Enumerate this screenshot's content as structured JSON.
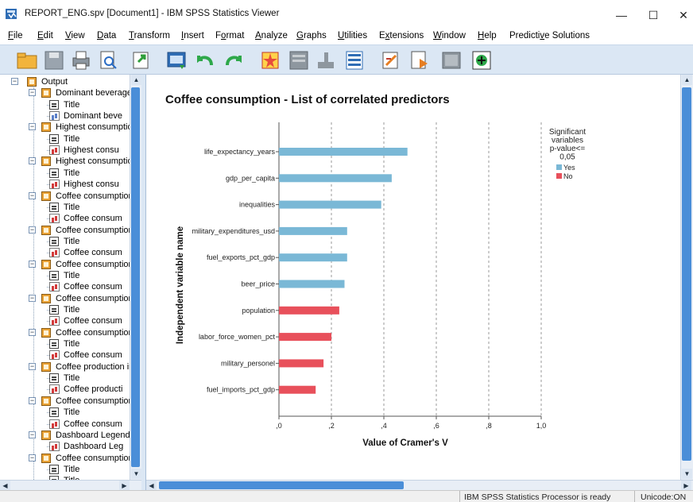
{
  "window": {
    "title": "REPORT_ENG.spv [Document1] - IBM SPSS Statistics Viewer",
    "minimize": "—",
    "maximize": "☐",
    "close": "✕"
  },
  "menu": [
    {
      "label": "File",
      "ul": "F",
      "rest": "ile"
    },
    {
      "label": "Edit",
      "ul": "E",
      "rest": "dit"
    },
    {
      "label": "View",
      "ul": "V",
      "rest": "iew"
    },
    {
      "label": "Data",
      "ul": "D",
      "rest": "ata"
    },
    {
      "label": "Transform",
      "ul": "T",
      "rest": "ransform"
    },
    {
      "label": "Insert",
      "ul": "I",
      "rest": "nsert"
    },
    {
      "label": "Format",
      "pre": "F",
      "ul": "o",
      "rest": "rmat"
    },
    {
      "label": "Analyze",
      "ul": "A",
      "rest": "nalyze"
    },
    {
      "label": "Graphs",
      "ul": "G",
      "rest": "raphs"
    },
    {
      "label": "Utilities",
      "ul": "U",
      "rest": "tilities"
    },
    {
      "label": "Extensions",
      "pre": "E",
      "ul": "x",
      "rest": "tensions"
    },
    {
      "label": "Window",
      "ul": "W",
      "rest": "indow"
    },
    {
      "label": "Help",
      "ul": "H",
      "rest": "elp"
    },
    {
      "label": "Predictive Solutions",
      "pre": "Predicti",
      "ul": "v",
      "rest": "e Solutions"
    }
  ],
  "toolbar": [
    "open-icon",
    "save-icon",
    "print-icon",
    "print-preview-icon",
    "export-icon",
    "recall-dialog-icon",
    "undo-icon",
    "redo-icon",
    "goto-data-icon",
    "goto-case-icon",
    "goto-variable-icon",
    "variables-icon",
    "insert-output-icon",
    "run-script-icon",
    "show-hide-icon",
    "designate-window-icon"
  ],
  "outline": {
    "root": "Output",
    "items": [
      {
        "kind": "folder",
        "label": "Dominant beverage"
      },
      {
        "kind": "title",
        "label": "Title"
      },
      {
        "kind": "chart",
        "color": "blue",
        "label": "Dominant beve"
      },
      {
        "kind": "folder",
        "label": "Highest consumptio"
      },
      {
        "kind": "title",
        "label": "Title"
      },
      {
        "kind": "chart",
        "color": "red",
        "label": "Highest consu"
      },
      {
        "kind": "folder",
        "label": "Highest consumptio"
      },
      {
        "kind": "title",
        "label": "Title"
      },
      {
        "kind": "chart",
        "color": "red",
        "label": "Highest consu"
      },
      {
        "kind": "folder",
        "label": "Coffee consumption"
      },
      {
        "kind": "title",
        "label": "Title"
      },
      {
        "kind": "chart",
        "color": "red",
        "label": "Coffee consum"
      },
      {
        "kind": "folder",
        "label": "Coffee consumption"
      },
      {
        "kind": "title",
        "label": "Title"
      },
      {
        "kind": "chart",
        "color": "red",
        "label": "Coffee consum"
      },
      {
        "kind": "folder",
        "label": "Coffee consumption"
      },
      {
        "kind": "title",
        "label": "Title"
      },
      {
        "kind": "chart",
        "color": "red",
        "label": "Coffee consum"
      },
      {
        "kind": "folder",
        "label": "Coffee consumption"
      },
      {
        "kind": "title",
        "label": "Title"
      },
      {
        "kind": "chart",
        "color": "red",
        "label": "Coffee consum"
      },
      {
        "kind": "folder",
        "label": "Coffee consumption"
      },
      {
        "kind": "title",
        "label": "Title"
      },
      {
        "kind": "chart",
        "color": "red",
        "label": "Coffee consum"
      },
      {
        "kind": "folder",
        "label": "Coffee production in"
      },
      {
        "kind": "title",
        "label": "Title"
      },
      {
        "kind": "chart",
        "color": "red",
        "label": "Coffee producti"
      },
      {
        "kind": "folder",
        "label": "Coffee consumption"
      },
      {
        "kind": "title",
        "label": "Title"
      },
      {
        "kind": "chart",
        "color": "red",
        "label": "Coffee consum"
      },
      {
        "kind": "folder",
        "label": "Dashboard Legend"
      },
      {
        "kind": "chart",
        "color": "red",
        "label": "Dashboard Leg"
      },
      {
        "kind": "folder",
        "label": "Coffee consumption"
      },
      {
        "kind": "title",
        "label": "Title"
      },
      {
        "kind": "title",
        "label": "Title"
      }
    ]
  },
  "chart_data": {
    "type": "bar",
    "orientation": "horizontal",
    "title": "Coffee consumption - List of correlated predictors",
    "xlabel": "Value of Cramer's V",
    "ylabel": "Independent variable name",
    "xlim": [
      0,
      1
    ],
    "xticks": [
      ",0",
      ",2",
      ",4",
      ",6",
      ",8",
      "1,0"
    ],
    "xtick_values": [
      0,
      0.2,
      0.4,
      0.6,
      0.8,
      1.0
    ],
    "grid": "vertical dashed",
    "categories": [
      "life_expectancy_years",
      "gdp_per_capita",
      "inequalities",
      "military_expenditures_usd",
      "fuel_exports_pct_gdp",
      "beer_price",
      "population",
      "labor_force_women_pct",
      "military_personel",
      "fuel_imports_pct_gdp"
    ],
    "values": [
      0.49,
      0.43,
      0.39,
      0.26,
      0.26,
      0.25,
      0.23,
      0.2,
      0.17,
      0.14
    ],
    "significant": [
      "Yes",
      "Yes",
      "Yes",
      "Yes",
      "Yes",
      "Yes",
      "No",
      "No",
      "No",
      "No"
    ],
    "legend": {
      "title_lines": [
        "Significant",
        "variables",
        "p-value<=",
        "0,05"
      ],
      "placement": "top-right",
      "entries": [
        {
          "label": "Yes",
          "color": "#7ab8d6"
        },
        {
          "label": "No",
          "color": "#e8505b"
        }
      ]
    },
    "colors": {
      "Yes": "#7ab8d6",
      "No": "#e8505b"
    }
  },
  "status": {
    "processor": "IBM SPSS Statistics Processor is ready",
    "unicode": "Unicode:ON"
  }
}
